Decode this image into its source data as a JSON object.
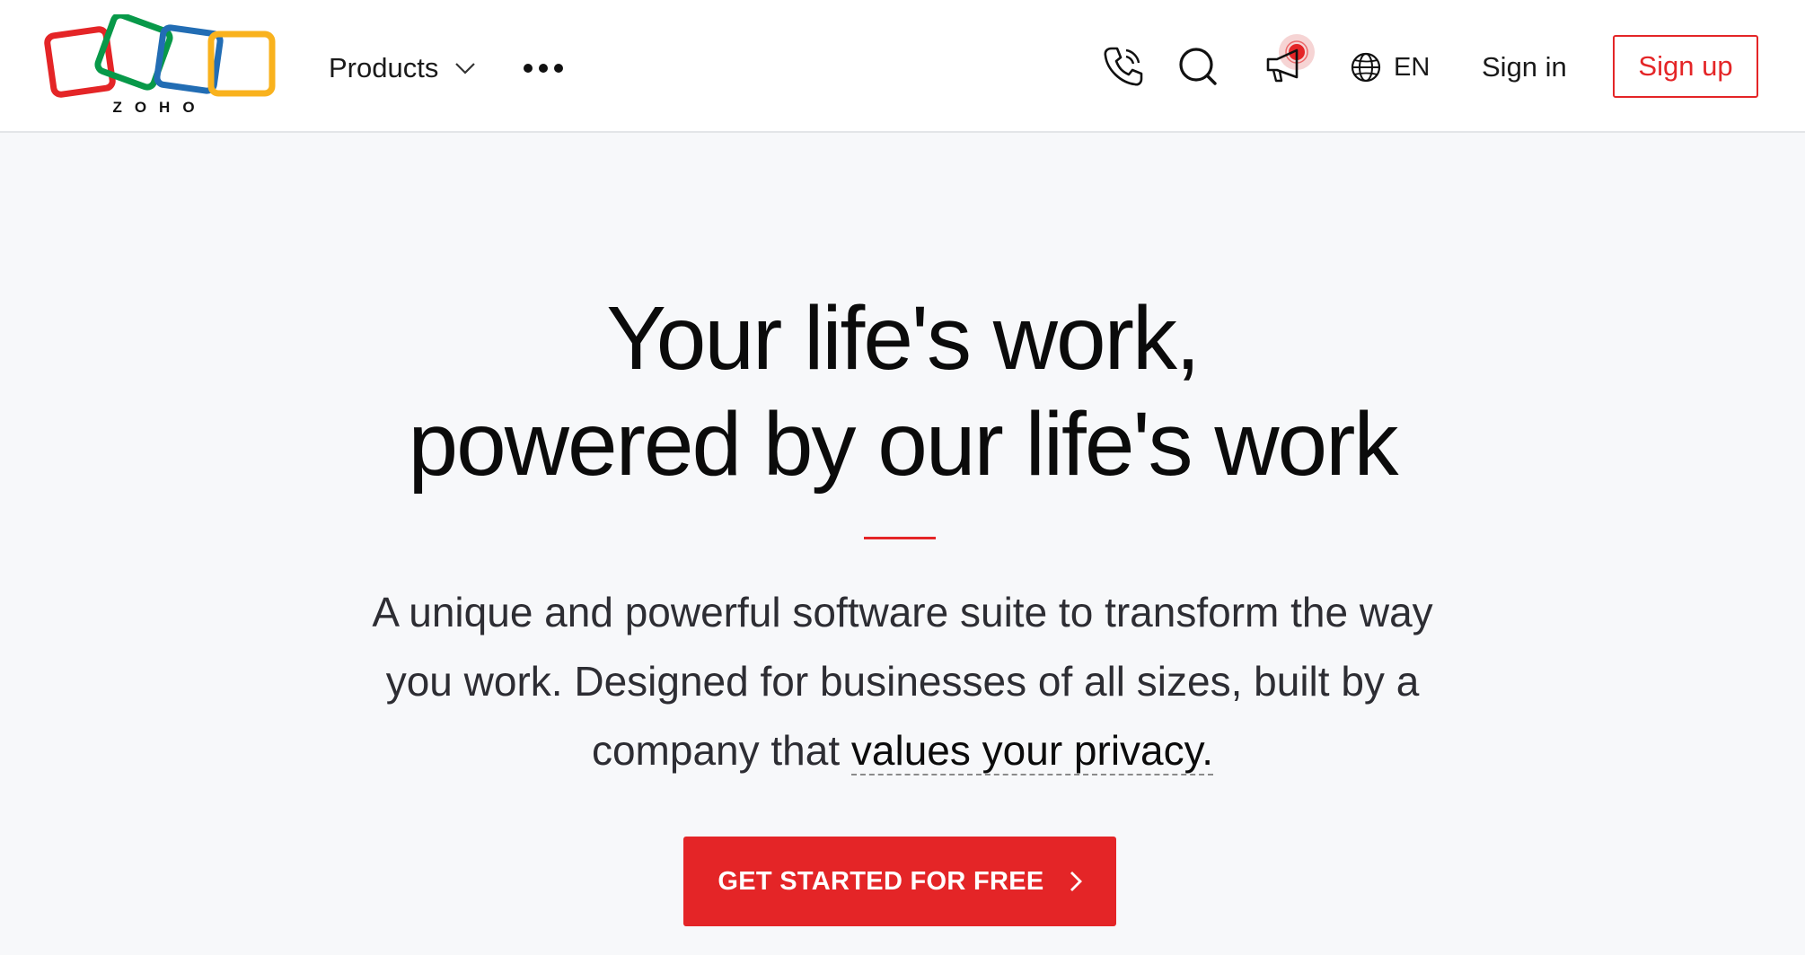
{
  "header": {
    "logo_text": "ZOHO",
    "nav": {
      "products_label": "Products"
    },
    "language": "EN",
    "signin_label": "Sign in",
    "signup_label": "Sign up"
  },
  "hero": {
    "title_line1": "Your life's work,",
    "title_line2": "powered by our life's work",
    "subtitle_text": "A unique and powerful software suite to transform the way you work. Designed for businesses of all sizes, built by a company that",
    "subtitle_link": "values your privacy.",
    "cta_label": "GET STARTED FOR FREE"
  },
  "icons": {
    "products_chevron": "chevron-down-icon",
    "more": "more-dots-icon",
    "phone": "phone-icon",
    "search": "search-icon",
    "announcements": "megaphone-icon",
    "language": "globe-icon",
    "cta_arrow": "chevron-right-icon"
  },
  "colors": {
    "brand_red": "#e42527",
    "logo_red": "#e42527",
    "logo_green": "#089949",
    "logo_blue": "#226db4",
    "logo_yellow": "#f9b21d",
    "hero_background": "#f7f8fa",
    "header_background": "#ffffff"
  }
}
